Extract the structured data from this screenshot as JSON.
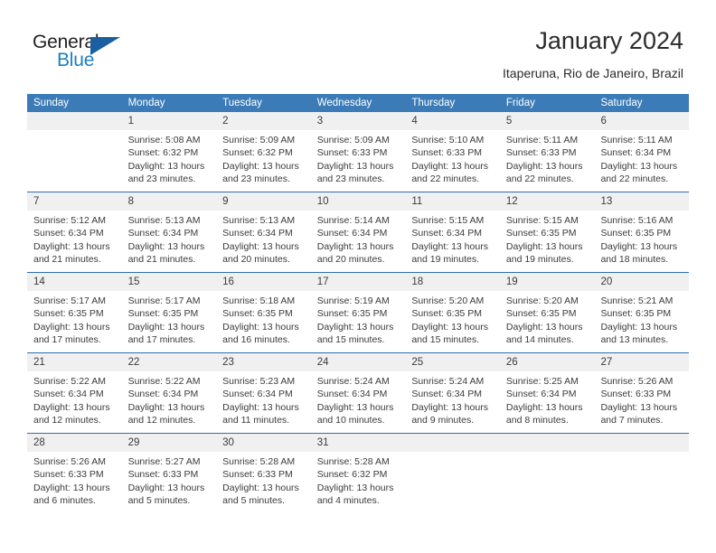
{
  "brand": {
    "name_part1": "General",
    "name_part2": "Blue"
  },
  "header": {
    "month_title": "January 2024",
    "location": "Itaperuna, Rio de Janeiro, Brazil"
  },
  "colors": {
    "header_blue": "#3b7cb8",
    "separator_blue": "#2f6fae",
    "number_strip": "#f0f0f0",
    "logo_blue": "#1a7fc1",
    "logo_triangle": "#1b5fa3",
    "text": "#3b3b3b"
  },
  "weekdays": [
    "Sunday",
    "Monday",
    "Tuesday",
    "Wednesday",
    "Thursday",
    "Friday",
    "Saturday"
  ],
  "weeks": [
    {
      "numbers": [
        "",
        "1",
        "2",
        "3",
        "4",
        "5",
        "6"
      ],
      "cells": [
        {
          "lines": [
            "",
            "",
            "",
            ""
          ]
        },
        {
          "lines": [
            "Sunrise: 5:08 AM",
            "Sunset: 6:32 PM",
            "Daylight: 13 hours",
            "and 23 minutes."
          ]
        },
        {
          "lines": [
            "Sunrise: 5:09 AM",
            "Sunset: 6:32 PM",
            "Daylight: 13 hours",
            "and 23 minutes."
          ]
        },
        {
          "lines": [
            "Sunrise: 5:09 AM",
            "Sunset: 6:33 PM",
            "Daylight: 13 hours",
            "and 23 minutes."
          ]
        },
        {
          "lines": [
            "Sunrise: 5:10 AM",
            "Sunset: 6:33 PM",
            "Daylight: 13 hours",
            "and 22 minutes."
          ]
        },
        {
          "lines": [
            "Sunrise: 5:11 AM",
            "Sunset: 6:33 PM",
            "Daylight: 13 hours",
            "and 22 minutes."
          ]
        },
        {
          "lines": [
            "Sunrise: 5:11 AM",
            "Sunset: 6:34 PM",
            "Daylight: 13 hours",
            "and 22 minutes."
          ]
        }
      ]
    },
    {
      "numbers": [
        "7",
        "8",
        "9",
        "10",
        "11",
        "12",
        "13"
      ],
      "cells": [
        {
          "lines": [
            "Sunrise: 5:12 AM",
            "Sunset: 6:34 PM",
            "Daylight: 13 hours",
            "and 21 minutes."
          ]
        },
        {
          "lines": [
            "Sunrise: 5:13 AM",
            "Sunset: 6:34 PM",
            "Daylight: 13 hours",
            "and 21 minutes."
          ]
        },
        {
          "lines": [
            "Sunrise: 5:13 AM",
            "Sunset: 6:34 PM",
            "Daylight: 13 hours",
            "and 20 minutes."
          ]
        },
        {
          "lines": [
            "Sunrise: 5:14 AM",
            "Sunset: 6:34 PM",
            "Daylight: 13 hours",
            "and 20 minutes."
          ]
        },
        {
          "lines": [
            "Sunrise: 5:15 AM",
            "Sunset: 6:34 PM",
            "Daylight: 13 hours",
            "and 19 minutes."
          ]
        },
        {
          "lines": [
            "Sunrise: 5:15 AM",
            "Sunset: 6:35 PM",
            "Daylight: 13 hours",
            "and 19 minutes."
          ]
        },
        {
          "lines": [
            "Sunrise: 5:16 AM",
            "Sunset: 6:35 PM",
            "Daylight: 13 hours",
            "and 18 minutes."
          ]
        }
      ]
    },
    {
      "numbers": [
        "14",
        "15",
        "16",
        "17",
        "18",
        "19",
        "20"
      ],
      "cells": [
        {
          "lines": [
            "Sunrise: 5:17 AM",
            "Sunset: 6:35 PM",
            "Daylight: 13 hours",
            "and 17 minutes."
          ]
        },
        {
          "lines": [
            "Sunrise: 5:17 AM",
            "Sunset: 6:35 PM",
            "Daylight: 13 hours",
            "and 17 minutes."
          ]
        },
        {
          "lines": [
            "Sunrise: 5:18 AM",
            "Sunset: 6:35 PM",
            "Daylight: 13 hours",
            "and 16 minutes."
          ]
        },
        {
          "lines": [
            "Sunrise: 5:19 AM",
            "Sunset: 6:35 PM",
            "Daylight: 13 hours",
            "and 15 minutes."
          ]
        },
        {
          "lines": [
            "Sunrise: 5:20 AM",
            "Sunset: 6:35 PM",
            "Daylight: 13 hours",
            "and 15 minutes."
          ]
        },
        {
          "lines": [
            "Sunrise: 5:20 AM",
            "Sunset: 6:35 PM",
            "Daylight: 13 hours",
            "and 14 minutes."
          ]
        },
        {
          "lines": [
            "Sunrise: 5:21 AM",
            "Sunset: 6:35 PM",
            "Daylight: 13 hours",
            "and 13 minutes."
          ]
        }
      ]
    },
    {
      "numbers": [
        "21",
        "22",
        "23",
        "24",
        "25",
        "26",
        "27"
      ],
      "cells": [
        {
          "lines": [
            "Sunrise: 5:22 AM",
            "Sunset: 6:34 PM",
            "Daylight: 13 hours",
            "and 12 minutes."
          ]
        },
        {
          "lines": [
            "Sunrise: 5:22 AM",
            "Sunset: 6:34 PM",
            "Daylight: 13 hours",
            "and 12 minutes."
          ]
        },
        {
          "lines": [
            "Sunrise: 5:23 AM",
            "Sunset: 6:34 PM",
            "Daylight: 13 hours",
            "and 11 minutes."
          ]
        },
        {
          "lines": [
            "Sunrise: 5:24 AM",
            "Sunset: 6:34 PM",
            "Daylight: 13 hours",
            "and 10 minutes."
          ]
        },
        {
          "lines": [
            "Sunrise: 5:24 AM",
            "Sunset: 6:34 PM",
            "Daylight: 13 hours",
            "and 9 minutes."
          ]
        },
        {
          "lines": [
            "Sunrise: 5:25 AM",
            "Sunset: 6:34 PM",
            "Daylight: 13 hours",
            "and 8 minutes."
          ]
        },
        {
          "lines": [
            "Sunrise: 5:26 AM",
            "Sunset: 6:33 PM",
            "Daylight: 13 hours",
            "and 7 minutes."
          ]
        }
      ]
    },
    {
      "numbers": [
        "28",
        "29",
        "30",
        "31",
        "",
        "",
        ""
      ],
      "cells": [
        {
          "lines": [
            "Sunrise: 5:26 AM",
            "Sunset: 6:33 PM",
            "Daylight: 13 hours",
            "and 6 minutes."
          ]
        },
        {
          "lines": [
            "Sunrise: 5:27 AM",
            "Sunset: 6:33 PM",
            "Daylight: 13 hours",
            "and 5 minutes."
          ]
        },
        {
          "lines": [
            "Sunrise: 5:28 AM",
            "Sunset: 6:33 PM",
            "Daylight: 13 hours",
            "and 5 minutes."
          ]
        },
        {
          "lines": [
            "Sunrise: 5:28 AM",
            "Sunset: 6:32 PM",
            "Daylight: 13 hours",
            "and 4 minutes."
          ]
        },
        {
          "lines": [
            "",
            "",
            "",
            ""
          ]
        },
        {
          "lines": [
            "",
            "",
            "",
            ""
          ]
        },
        {
          "lines": [
            "",
            "",
            "",
            ""
          ]
        }
      ]
    }
  ]
}
